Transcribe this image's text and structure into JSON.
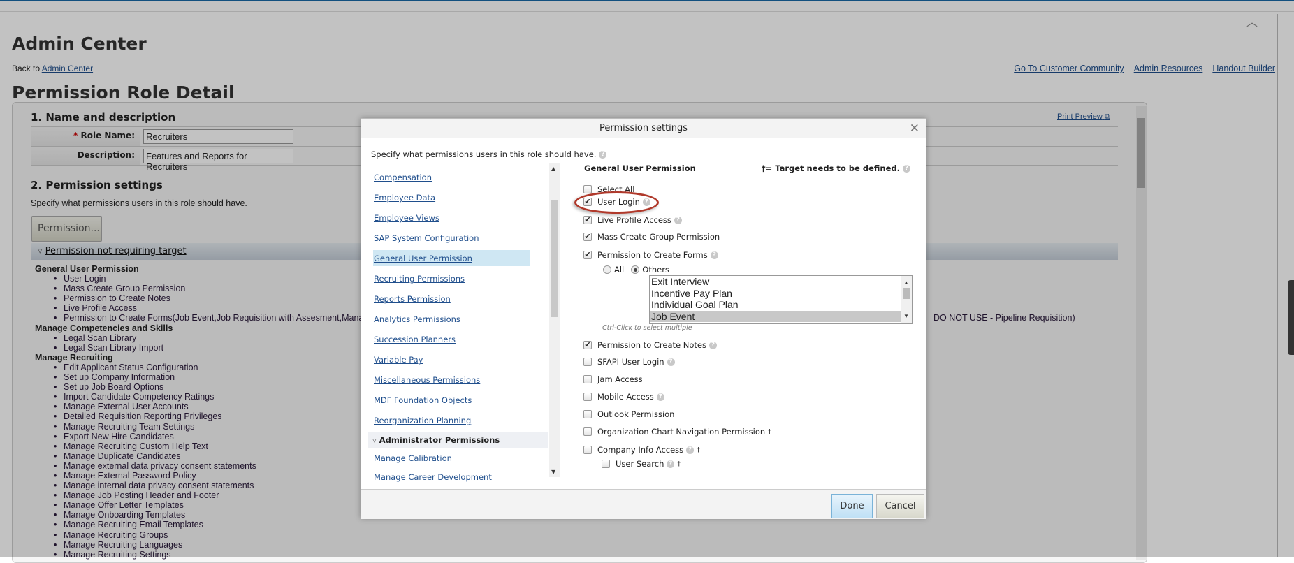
{
  "page": {
    "title": "Admin Center",
    "back_prefix": "Back to ",
    "back_link": "Admin Center",
    "top_links": [
      "Go To Customer Community",
      "Admin Resources",
      "Handout Builder"
    ],
    "role_title": "Permission Role Detail",
    "print_preview": "Print Preview"
  },
  "section1": {
    "heading": "1. Name and description",
    "required_mark": "*",
    "role_name_label": "Role Name:",
    "role_name_value": "Recruiters",
    "description_label": "Description:",
    "description_value": "Features and Reports for Recruiters"
  },
  "section2": {
    "heading": "2. Permission settings",
    "intro": "Specify what permissions users in this role should have.",
    "permission_button": "Permission...",
    "bar_label": "Permission not requiring target",
    "groups": [
      {
        "name": "General User Permission",
        "items": [
          "User Login",
          "Mass Create Group Permission",
          "Permission to Create Notes",
          "Live Profile Access",
          "Permission to Create Forms(Job Event,Job Requisition with Assesment,Manag"
        ]
      },
      {
        "name": "Manage Competencies and Skills",
        "items": [
          "Legal Scan Library",
          "Legal Scan Library Import"
        ]
      },
      {
        "name": "Manage Recruiting",
        "items": [
          "Edit Applicant Status Configuration",
          "Set up Company Information",
          "Set up Job Board Options",
          "Import Candidate Competency Ratings",
          "Manage External User Accounts",
          "Detailed Requisition Reporting Privileges",
          "Manage Recruiting Team Settings",
          "Export New Hire Candidates",
          "Manage Recruiting Custom Help Text",
          "Manage Duplicate Candidates",
          "Manage external data privacy consent statements",
          "Manage External Password Policy",
          "Manage internal data privacy consent statements",
          "Manage Job Posting Header and Footer",
          "Manage Offer Letter Templates",
          "Manage Onboarding Templates",
          "Manage Recruiting Email Templates",
          "Manage Recruiting Groups",
          "Manage Recruiting Languages",
          "Manage Recruiting Settings"
        ]
      }
    ],
    "forms_tail": "DO NOT USE - Pipeline Requisition)"
  },
  "dialog": {
    "title": "Permission settings",
    "intro": "Specify what permissions users in this role should have.",
    "nav": [
      "Compensation",
      "Employee Data",
      "Employee Views",
      "SAP System Configuration",
      "General User Permission",
      "Recruiting Permissions",
      "Reports Permission",
      "Analytics Permissions",
      "Succession Planners",
      "Variable Pay",
      "Miscellaneous Permissions",
      "MDF Foundation Objects",
      "Reorganization Planning"
    ],
    "nav_selected": "General User Permission",
    "admin_header": "Administrator Permissions",
    "admin_nav": [
      "Manage Calibration",
      "Manage Career Development"
    ],
    "right_heading": "General User Permission",
    "target_note": "†= Target needs to be defined.",
    "select_all": "Select All",
    "permissions": [
      {
        "label": "User Login",
        "checked": true,
        "help": true,
        "target": ""
      },
      {
        "label": "Live Profile Access",
        "checked": true,
        "help": true,
        "target": ""
      },
      {
        "label": "Mass Create Group Permission",
        "checked": true,
        "help": false,
        "target": ""
      },
      {
        "label": "Permission to Create Forms",
        "checked": true,
        "help": true,
        "target": ""
      },
      {
        "label": "Permission to Create Notes",
        "checked": true,
        "help": true,
        "target": ""
      },
      {
        "label": "SFAPI User Login",
        "checked": false,
        "help": true,
        "target": ""
      },
      {
        "label": "Jam Access",
        "checked": false,
        "help": false,
        "target": ""
      },
      {
        "label": "Mobile Access",
        "checked": false,
        "help": true,
        "target": ""
      },
      {
        "label": "Outlook Permission",
        "checked": false,
        "help": false,
        "target": ""
      },
      {
        "label": "Organization Chart Navigation Permission",
        "checked": false,
        "help": false,
        "target": "†"
      },
      {
        "label": "Company Info Access",
        "checked": false,
        "help": true,
        "target": "†"
      },
      {
        "label": "User Search",
        "checked": false,
        "help": true,
        "target": "†"
      }
    ],
    "radio_all": "All",
    "radio_others": "Others",
    "radio_selected": "Others",
    "forms_list": [
      "Exit Interview",
      "Incentive Pay Plan",
      "Individual Goal Plan",
      "Job Event"
    ],
    "forms_selected": "Job Event",
    "hint": "Ctrl-Click to select multiple",
    "done": "Done",
    "cancel": "Cancel",
    "highlight_color": "#b0392b"
  }
}
